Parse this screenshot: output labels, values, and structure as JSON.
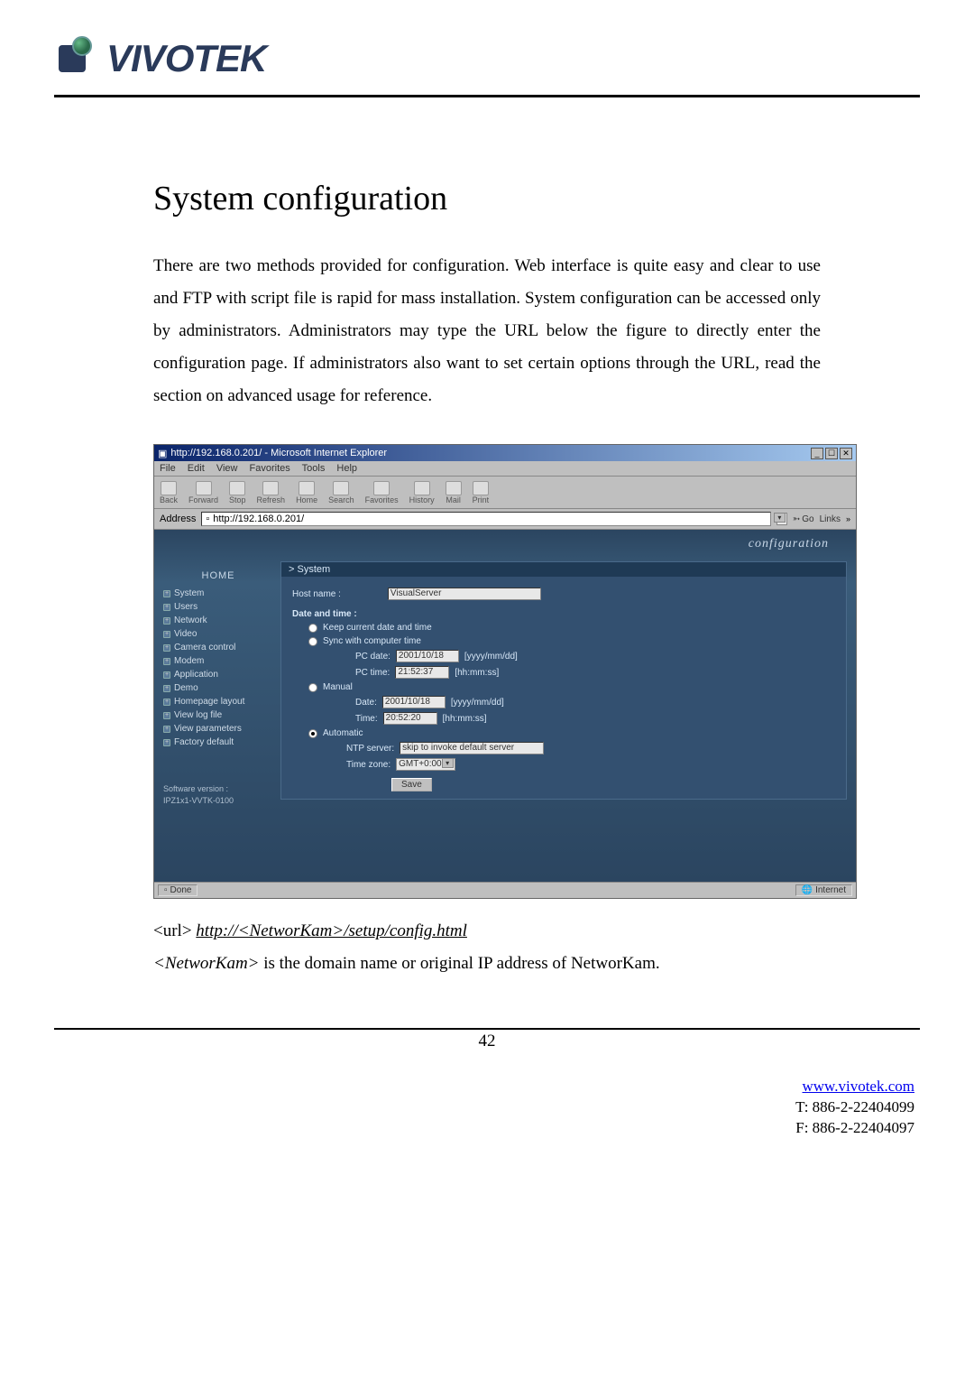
{
  "logo_text": "VIVOTEK",
  "heading": "System configuration",
  "intro": "There are two methods provided for configuration. Web interface is quite easy and clear to use and FTP with script file is rapid for mass installation. System configuration can be accessed only by administrators. Administrators may type the URL below the figure to directly enter the configuration page. If administrators also want to set certain options through the URL, read the section on advanced usage for reference.",
  "ie": {
    "title": "http://192.168.0.201/ - Microsoft Internet Explorer",
    "menu": [
      "File",
      "Edit",
      "View",
      "Favorites",
      "Tools",
      "Help"
    ],
    "toolbar": [
      "Back",
      "Forward",
      "Stop",
      "Refresh",
      "Home",
      "Search",
      "Favorites",
      "History",
      "Mail",
      "Print"
    ],
    "addr_label": "Address",
    "addr": "http://192.168.0.201/",
    "go": "Go",
    "links": "Links",
    "status_done": "Done",
    "status_zone": "Internet"
  },
  "cfg": {
    "title_right": "configuration",
    "sidebar": {
      "home": "HOME",
      "items": [
        "System",
        "Users",
        "Network",
        "Video",
        "Camera control",
        "Modem",
        "Application",
        "Demo",
        "Homepage layout",
        "View log file",
        "View parameters",
        "Factory default"
      ],
      "sw_label": "Software version :",
      "sw_value": "IPZ1x1-VVTK-0100"
    },
    "panel_title": "> System",
    "hostname_label": "Host name :",
    "hostname_value": "VisualServer",
    "dt_heading": "Date and time :",
    "opts": {
      "keep": "Keep current date and time",
      "sync": "Sync with computer time",
      "pc_date_label": "PC date:",
      "pc_date_value": "2001/10/18",
      "pc_date_fmt": "[yyyy/mm/dd]",
      "pc_time_label": "PC time:",
      "pc_time_value": "21:52:37",
      "pc_time_fmt": "[hh:mm:ss]",
      "manual": "Manual",
      "m_date_label": "Date:",
      "m_date_value": "2001/10/18",
      "m_date_fmt": "[yyyy/mm/dd]",
      "m_time_label": "Time:",
      "m_time_value": "20:52:20",
      "m_time_fmt": "[hh:mm:ss]",
      "auto": "Automatic",
      "ntp_label": "NTP server:",
      "ntp_value": "skip to invoke default server",
      "tz_label": "Time zone:",
      "tz_value": "GMT+0:00"
    },
    "save": "Save"
  },
  "url_line_prefix": "<url>",
  "url_line_link": "http://<NetworKam>/setup/config.html",
  "caption_em": "<NetworKam>",
  "caption_rest": " is the domain name or original IP address of NetworKam.",
  "page_num": "42",
  "footer": {
    "site": "www.vivotek.com",
    "tel": "T: 886-2-22404099",
    "fax": "F: 886-2-22404097"
  }
}
